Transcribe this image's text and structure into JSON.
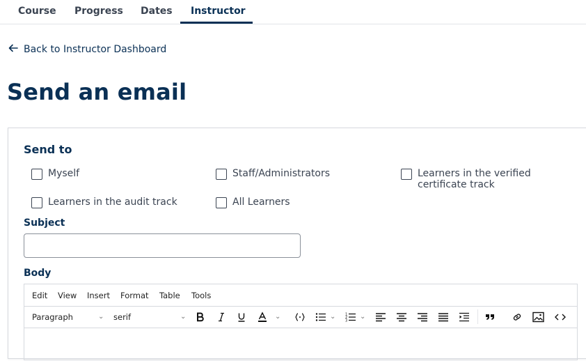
{
  "nav": {
    "tabs": [
      {
        "label": "Course"
      },
      {
        "label": "Progress"
      },
      {
        "label": "Dates"
      },
      {
        "label": "Instructor",
        "active": true
      }
    ]
  },
  "back_link": {
    "label": "Back to Instructor Dashboard",
    "icon": "arrow-left-icon"
  },
  "page_title": "Send an email",
  "form": {
    "send_to_label": "Send to",
    "recipients": [
      {
        "label": "Myself",
        "checked": false
      },
      {
        "label": "Staff/Administrators",
        "checked": false
      },
      {
        "label_line1": "Learners in the verified",
        "label_line2": "certificate track",
        "checked": false
      },
      {
        "label": "Learners in the audit track",
        "checked": false
      },
      {
        "label": "All Learners",
        "checked": false
      }
    ],
    "subject_label": "Subject",
    "subject_value": "",
    "body_label": "Body"
  },
  "editor": {
    "menus": [
      "Edit",
      "View",
      "Insert",
      "Format",
      "Table",
      "Tools"
    ],
    "toolbar": {
      "block_format": "Paragraph",
      "font_family": "serif",
      "buttons": [
        "bold-icon",
        "italic-icon",
        "underline-icon",
        "text-color-icon",
        "code-sample-icon",
        "bullet-list-icon",
        "numbered-list-icon",
        "align-left-icon",
        "align-center-icon",
        "align-right-icon",
        "align-justify-icon",
        "indent-icon",
        "blockquote-icon",
        "link-icon",
        "image-icon",
        "source-code-icon"
      ]
    }
  },
  "colors": {
    "brand": "#0a3055",
    "text": "#3b4452",
    "border": "#d6d9de"
  }
}
